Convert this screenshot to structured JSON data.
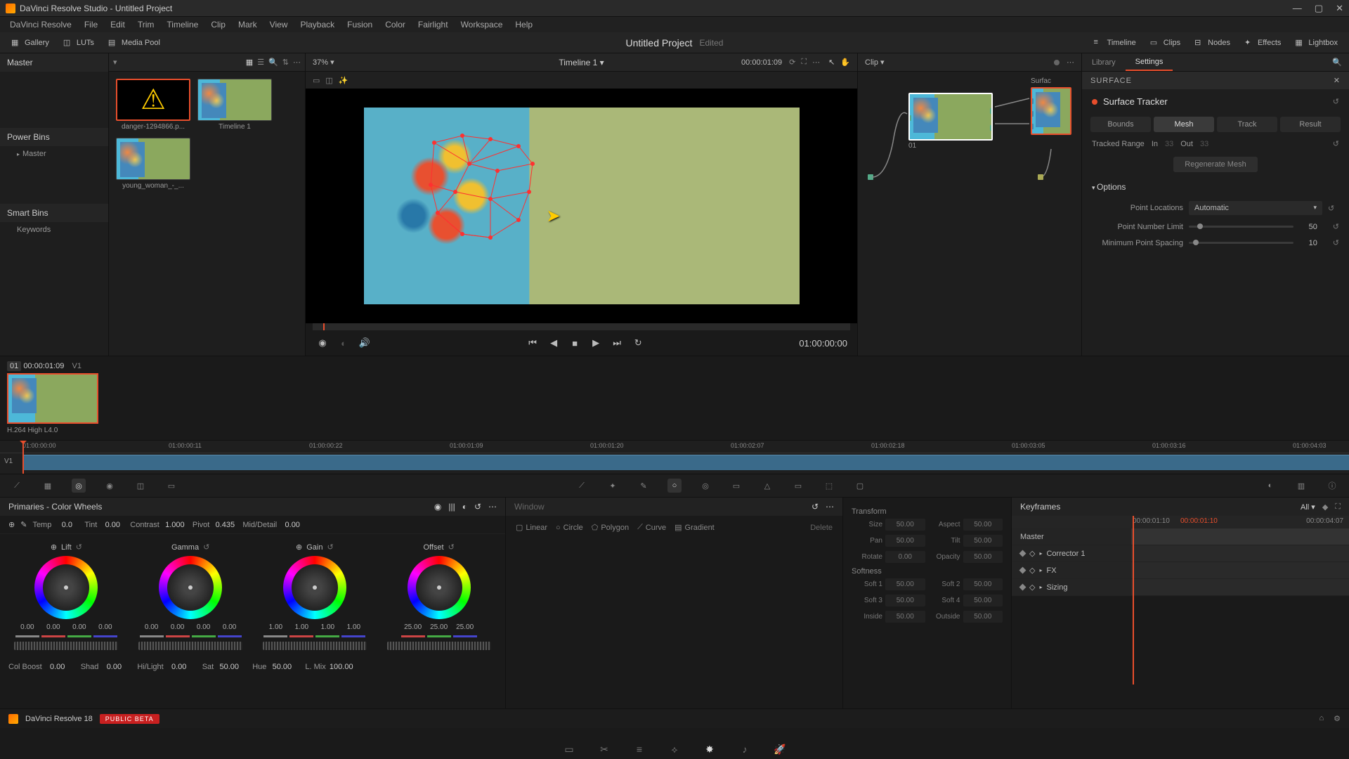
{
  "window": {
    "title": "DaVinci Resolve Studio - Untitled Project"
  },
  "menubar": [
    "DaVinci Resolve",
    "File",
    "Edit",
    "Trim",
    "Timeline",
    "Clip",
    "Mark",
    "View",
    "Playback",
    "Fusion",
    "Color",
    "Fairlight",
    "Workspace",
    "Help"
  ],
  "toolbar": {
    "gallery": "Gallery",
    "luts": "LUTs",
    "mediapool": "Media Pool",
    "project_name": "Untitled Project",
    "project_status": "Edited",
    "timeline": "Timeline",
    "clips": "Clips",
    "nodes": "Nodes",
    "effects": "Effects",
    "lightbox": "Lightbox"
  },
  "leftpanel": {
    "master": "Master",
    "powerbins": "Power Bins",
    "powerbins_master": "Master",
    "smartbins": "Smart Bins",
    "keywords": "Keywords"
  },
  "mediapool": {
    "items": [
      {
        "label": "danger-1294866.p..."
      },
      {
        "label": "Timeline 1"
      },
      {
        "label": "young_woman_-_..."
      }
    ]
  },
  "viewer": {
    "zoom": "37%",
    "title": "Timeline 1",
    "header_tc": "00:00:01:09",
    "transport_tc": "01:00:00:00"
  },
  "nodepanel": {
    "header": "Clip",
    "node1_label": "01",
    "node2_label": "Surfac"
  },
  "surface": {
    "lib_tab": "Library",
    "settings_tab": "Settings",
    "caption": "SURFACE",
    "tracker_name": "Surface Tracker",
    "tabs": {
      "bounds": "Bounds",
      "mesh": "Mesh",
      "track": "Track",
      "result": "Result"
    },
    "tracked_range": "Tracked Range",
    "in_label": "In",
    "in_val": "33",
    "out_label": "Out",
    "out_val": "33",
    "regenerate": "Regenerate Mesh",
    "options": "Options",
    "point_locations_label": "Point Locations",
    "point_locations_val": "Automatic",
    "point_limit_label": "Point Number Limit",
    "point_limit_val": "50",
    "min_spacing_label": "Minimum Point Spacing",
    "min_spacing_val": "10"
  },
  "clipstrip": {
    "info_index": "01",
    "info_tc": "00:00:01:09",
    "info_track": "V1",
    "codec": "H.264 High L4.0"
  },
  "timeline": {
    "track_label": "V1",
    "ticks": [
      "01:00:00:00",
      "01:00:00:11",
      "01:00:00:22",
      "01:00:01:09",
      "01:00:01:20",
      "01:00:02:07",
      "01:00:02:18",
      "01:00:03:05",
      "01:00:03:16",
      "01:00:04:03"
    ]
  },
  "colorwheels": {
    "title": "Primaries - Color Wheels",
    "adjusters": {
      "temp": {
        "label": "Temp",
        "val": "0.0"
      },
      "tint": {
        "label": "Tint",
        "val": "0.00"
      },
      "contrast": {
        "label": "Contrast",
        "val": "1.000"
      },
      "pivot": {
        "label": "Pivot",
        "val": "0.435"
      },
      "middetail": {
        "label": "Mid/Detail",
        "val": "0.00"
      }
    },
    "wheels": [
      {
        "name": "Lift",
        "vals": [
          "0.00",
          "0.00",
          "0.00",
          "0.00"
        ]
      },
      {
        "name": "Gamma",
        "vals": [
          "0.00",
          "0.00",
          "0.00",
          "0.00"
        ]
      },
      {
        "name": "Gain",
        "vals": [
          "1.00",
          "1.00",
          "1.00",
          "1.00"
        ]
      },
      {
        "name": "Offset",
        "vals": [
          "25.00",
          "25.00",
          "25.00"
        ]
      }
    ],
    "bottom": {
      "colboost": {
        "label": "Col Boost",
        "val": "0.00"
      },
      "shad": {
        "label": "Shad",
        "val": "0.00"
      },
      "hilight": {
        "label": "Hi/Light",
        "val": "0.00"
      },
      "sat": {
        "label": "Sat",
        "val": "50.00"
      },
      "hue": {
        "label": "Hue",
        "val": "50.00"
      },
      "lmix": {
        "label": "L. Mix",
        "val": "100.00"
      }
    }
  },
  "windowpanel": {
    "title": "Window",
    "tools": {
      "linear": "Linear",
      "circle": "Circle",
      "polygon": "Polygon",
      "curve": "Curve",
      "gradient": "Gradient",
      "delete": "Delete"
    }
  },
  "transform": {
    "title": "Transform",
    "size": {
      "label": "Size",
      "val": "50.00"
    },
    "aspect": {
      "label": "Aspect",
      "val": "50.00"
    },
    "pan": {
      "label": "Pan",
      "val": "50.00"
    },
    "tilt": {
      "label": "Tilt",
      "val": "50.00"
    },
    "rotate": {
      "label": "Rotate",
      "val": "0.00"
    },
    "opacity": {
      "label": "Opacity",
      "val": "50.00"
    },
    "softness_title": "Softness",
    "soft1": {
      "label": "Soft 1",
      "val": "50.00"
    },
    "soft2": {
      "label": "Soft 2",
      "val": "50.00"
    },
    "soft3": {
      "label": "Soft 3",
      "val": "50.00"
    },
    "soft4": {
      "label": "Soft 4",
      "val": "50.00"
    },
    "inside": {
      "label": "Inside",
      "val": "50.00"
    },
    "outside": {
      "label": "Outside",
      "val": "50.00"
    }
  },
  "keyframes": {
    "title": "Keyframes",
    "mode": "All",
    "tc_start": "00:00:01:10",
    "tc_mid": "00:00:01:10",
    "tc_end": "00:00:04:07",
    "tracks": {
      "master": "Master",
      "corrector": "Corrector 1",
      "fx": "FX",
      "sizing": "Sizing"
    }
  },
  "bottombar": {
    "app": "DaVinci Resolve 18",
    "beta": "PUBLIC BETA"
  }
}
